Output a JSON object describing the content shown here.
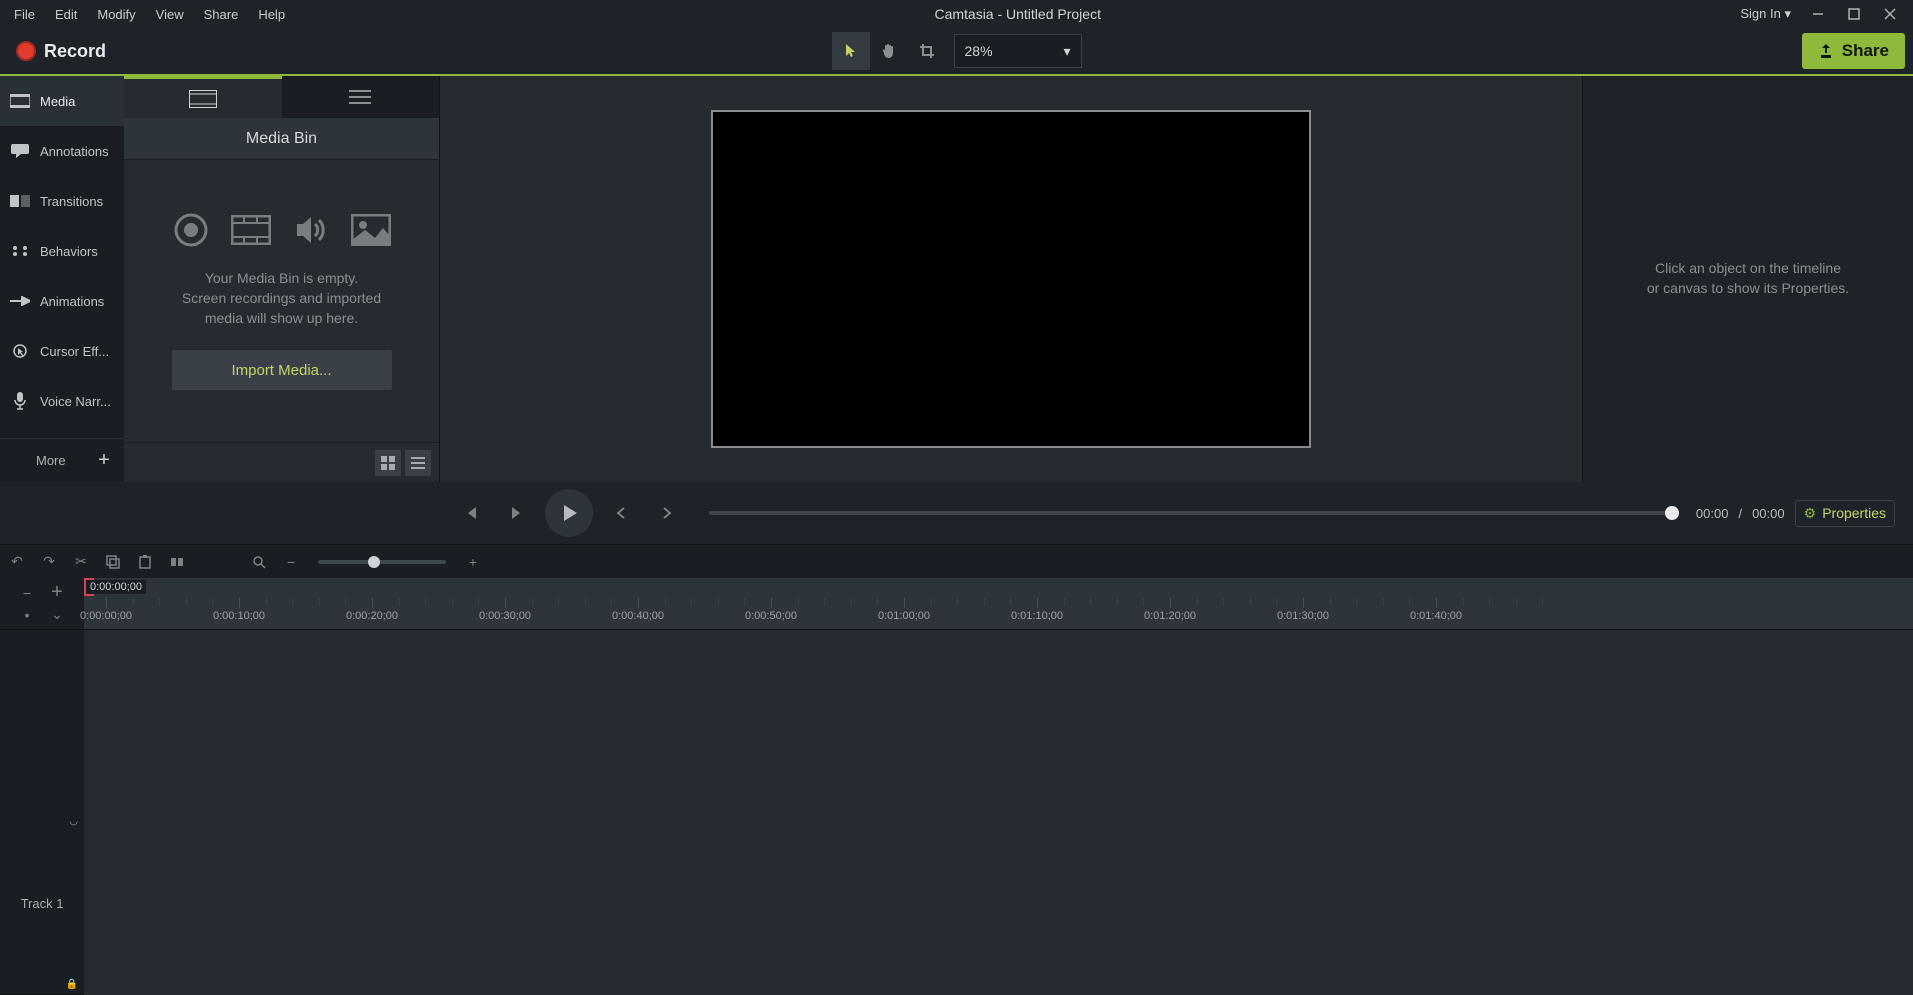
{
  "menubar": {
    "items": [
      "File",
      "Edit",
      "Modify",
      "View",
      "Share",
      "Help"
    ],
    "title": "Camtasia - Untitled Project",
    "signin": "Sign In ▾"
  },
  "toolbar": {
    "record": "Record",
    "zoom": "28%",
    "share": "Share"
  },
  "left_tools": [
    {
      "label": "Media",
      "icon": "media"
    },
    {
      "label": "Annotations",
      "icon": "annotation"
    },
    {
      "label": "Transitions",
      "icon": "transition"
    },
    {
      "label": "Behaviors",
      "icon": "behavior"
    },
    {
      "label": "Animations",
      "icon": "animation"
    },
    {
      "label": "Cursor Eff...",
      "icon": "cursor"
    },
    {
      "label": "Voice Narr...",
      "icon": "voice"
    }
  ],
  "left_more": "More",
  "media_bin": {
    "title": "Media Bin",
    "empty_msg": "Your Media Bin is empty.\nScreen recordings and imported\nmedia will show up here.",
    "import_btn": "Import Media..."
  },
  "properties": {
    "empty_msg": "Click an object on the timeline\nor canvas to show its Properties."
  },
  "playback": {
    "current": "00:00",
    "sep": "/",
    "total": "00:00",
    "props_label": "Properties"
  },
  "timeline": {
    "playhead_time": "0:00:00;00",
    "ticks": [
      "0:00:00;00",
      "0:00:10;00",
      "0:00:20;00",
      "0:00:30;00",
      "0:00:40;00",
      "0:00:50;00",
      "0:01:00;00",
      "0:01:10;00",
      "0:01:20;00",
      "0:01:30;00",
      "0:01:40;00"
    ],
    "track1": "Track 1"
  }
}
